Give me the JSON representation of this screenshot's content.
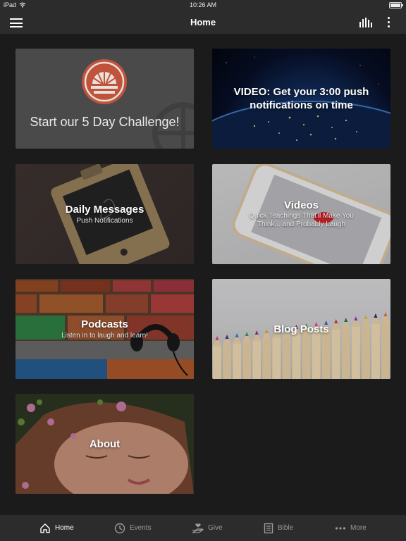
{
  "status_bar": {
    "device": "iPad",
    "time": "10:26 AM"
  },
  "header": {
    "title": "Home"
  },
  "cards": [
    {
      "title": "Start our 5 Day Challenge!",
      "subtitle": ""
    },
    {
      "title": "VIDEO: Get your 3:00 push notifications on time",
      "subtitle": ""
    },
    {
      "title": "Daily Messages",
      "subtitle": "Push Notifications"
    },
    {
      "title": "Videos",
      "subtitle": "Quick Teachings That'll Make You Think... and Probably Laugh"
    },
    {
      "title": "Podcasts",
      "subtitle": "Listen in to laugh and learn!"
    },
    {
      "title": "Blog Posts",
      "subtitle": ""
    },
    {
      "title": "About",
      "subtitle": ""
    }
  ],
  "tabs": [
    {
      "label": "Home",
      "icon": "home-icon",
      "active": true
    },
    {
      "label": "Events",
      "icon": "clock-icon",
      "active": false
    },
    {
      "label": "Give",
      "icon": "give-icon",
      "active": false
    },
    {
      "label": "Bible",
      "icon": "bible-icon",
      "active": false
    },
    {
      "label": "More",
      "icon": "more-icon",
      "active": false
    }
  ],
  "colors": {
    "background": "#1b1b1c",
    "bar": "#2c2c2d",
    "challenge_logo": "#c0533c",
    "tab_active": "#ffffff",
    "tab_inactive": "#9a9a9a"
  }
}
